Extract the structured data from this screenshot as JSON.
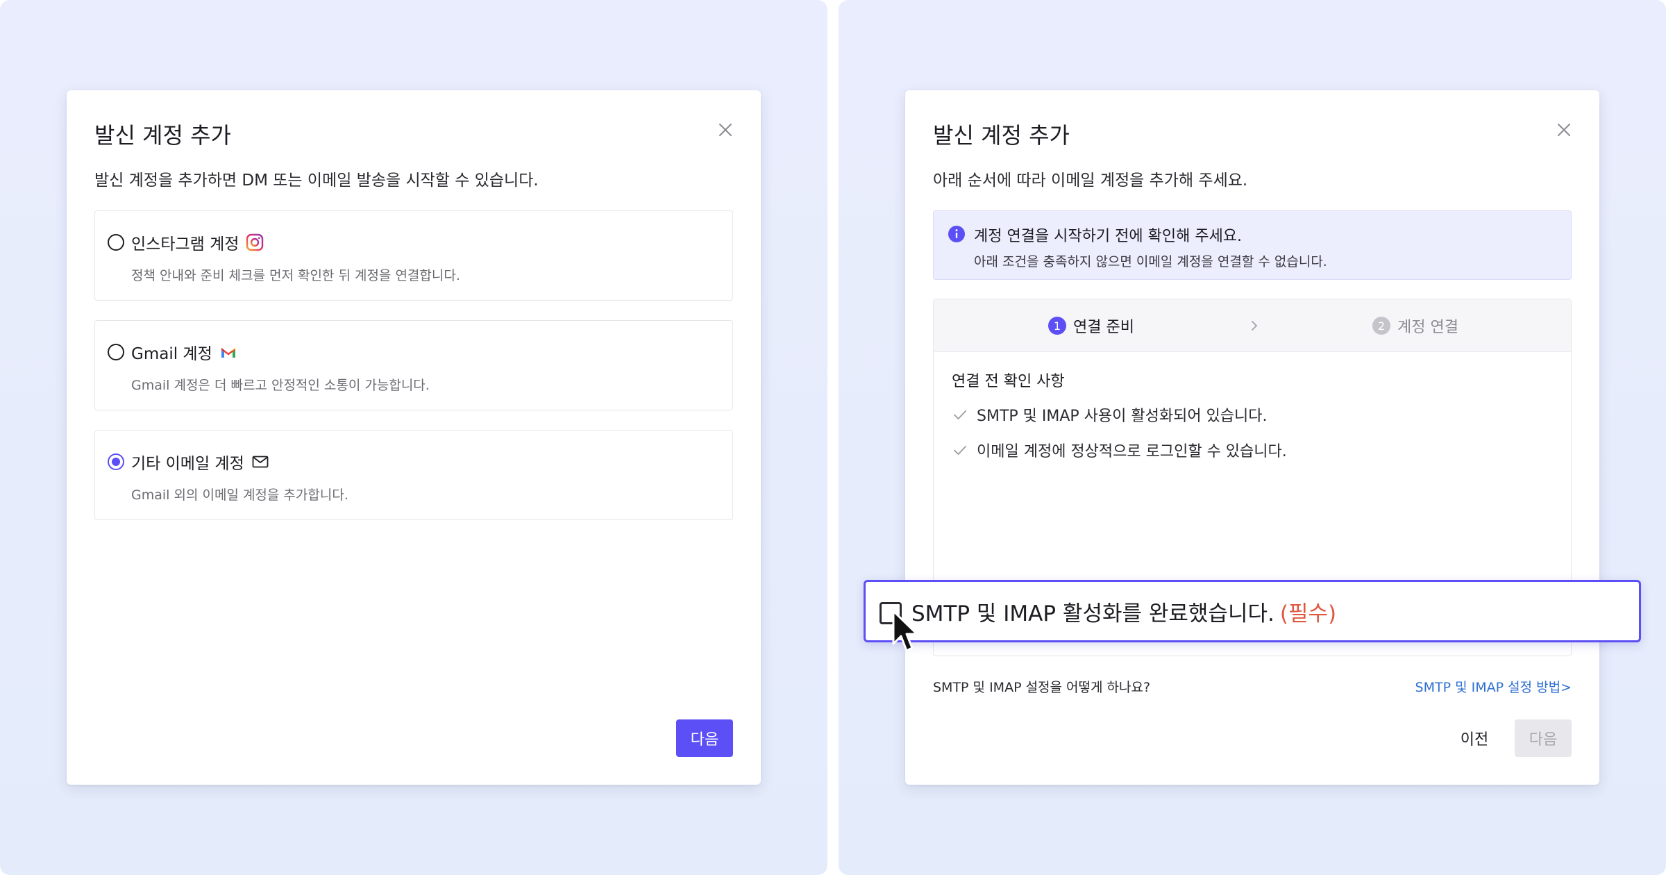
{
  "colors": {
    "accent": "#5b4ff5",
    "link": "#2f6fd0",
    "required": "#e0563f"
  },
  "left_modal": {
    "title": "발신 계정 추가",
    "description": "발신 계정을 추가하면 DM 또는 이메일 발송을 시작할 수 있습니다.",
    "close_icon": "close-icon",
    "options": [
      {
        "label": "인스타그램 계정",
        "icon": "instagram-icon",
        "description": "정책 안내와 준비 체크를 먼저 확인한 뒤 계정을 연결합니다.",
        "selected": false
      },
      {
        "label": "Gmail 계정",
        "icon": "gmail-icon",
        "description": "Gmail 계정은 더 빠르고 안정적인 소통이 가능합니다.",
        "selected": false
      },
      {
        "label": "기타 이메일 계정",
        "icon": "mail-icon",
        "description": "Gmail 외의 이메일 계정을 추가합니다.",
        "selected": true
      }
    ],
    "next_label": "다음"
  },
  "right_modal": {
    "title": "발신 계정 추가",
    "description": "아래 순서에 따라 이메일 계정을 추가해 주세요.",
    "info": {
      "title": "계정 연결을 시작하기 전에 확인해 주세요.",
      "subtitle": "아래 조건을 충족하지 않으면 이메일 계정을 연결할 수 없습니다."
    },
    "steps": [
      {
        "number": "1",
        "label": "연결 준비",
        "active": true
      },
      {
        "number": "2",
        "label": "계정 연결",
        "active": false
      }
    ],
    "checklist_title": "연결 전 확인 사항",
    "checklist": [
      "SMTP 및 IMAP 사용이 활성화되어 있습니다.",
      "이메일 계정에 정상적으로 로그인할 수 있습니다."
    ],
    "confirm": {
      "label": "SMTP 및 IMAP 활성화를 완료했습니다.",
      "required": "(필수)",
      "checked": false
    },
    "help_question": "SMTP 및 IMAP 설정을 어떻게 하나요?",
    "help_link": "SMTP 및 IMAP 설정 방법>",
    "prev_label": "이전",
    "next_label": "다음"
  }
}
